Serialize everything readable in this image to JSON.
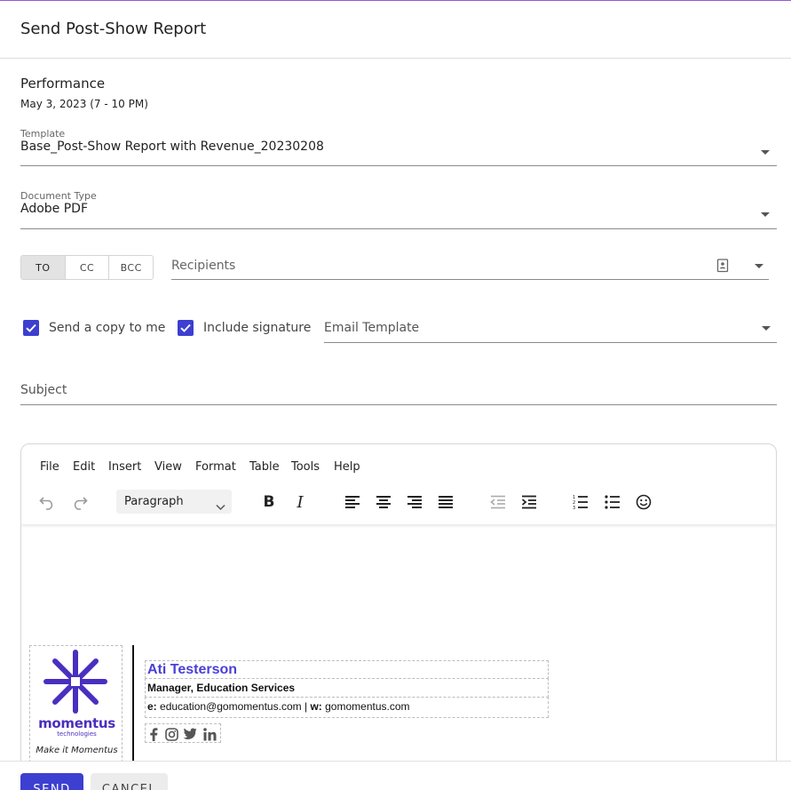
{
  "dialog": {
    "title": "Send Post-Show Report"
  },
  "performance": {
    "heading": "Performance",
    "date": "May 3, 2023 (7 - 10 PM)"
  },
  "template_field": {
    "label": "Template",
    "value": "Base_Post-Show Report with Revenue_20230208"
  },
  "doctype_field": {
    "label": "Document Type",
    "value": "Adobe PDF"
  },
  "recipient_modes": {
    "items": [
      "TO",
      "CC",
      "BCC"
    ],
    "selected": "TO"
  },
  "recipients": {
    "placeholder": "Recipients"
  },
  "options": {
    "send_copy": {
      "label": "Send a copy to me",
      "checked": true
    },
    "include_signature": {
      "label": "Include signature",
      "checked": true
    }
  },
  "email_template": {
    "placeholder": "Email Template"
  },
  "subject": {
    "placeholder": "Subject"
  },
  "editor": {
    "menu": [
      "File",
      "Edit",
      "Insert",
      "View",
      "Format",
      "Table",
      "Tools",
      "Help"
    ],
    "block_format": "Paragraph",
    "toolbar_icons": [
      "undo-icon",
      "redo-icon",
      "bold-icon",
      "italic-icon",
      "align-left-icon",
      "align-center-icon",
      "align-right-icon",
      "align-justify-icon",
      "outdent-icon",
      "indent-icon",
      "numbered-list-icon",
      "bullet-list-icon",
      "emoji-icon"
    ]
  },
  "signature": {
    "logo_word": "momentus",
    "logo_sub": "technologies",
    "tagline": "Make it Momentus",
    "name": "Ati Testerson",
    "role": "Manager, Education Services",
    "email_prefix": "e:",
    "email": "education@gomomentus.com",
    "separator": "|",
    "web_prefix": "w:",
    "web": "gomomentus.com",
    "social_icons": [
      "facebook-icon",
      "instagram-icon",
      "twitter-icon",
      "linkedin-icon"
    ]
  },
  "actions": {
    "send": "SEND",
    "cancel": "CANCEL"
  },
  "colors": {
    "accent": "#3c3fd0",
    "signature_name": "#4a3fd6",
    "logo": "#4a2fbf",
    "top_border": "#9b59d0"
  }
}
